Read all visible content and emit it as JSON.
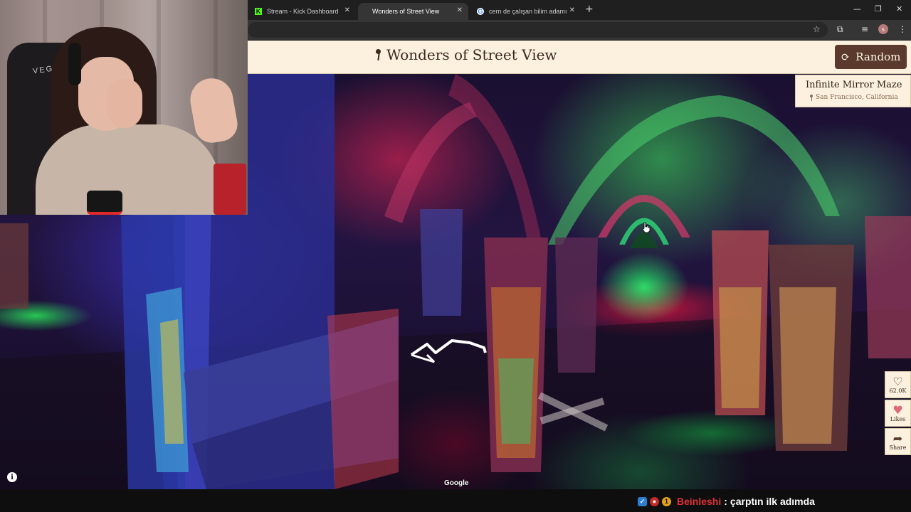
{
  "browser": {
    "tabs": [
      {
        "title": "Stream - Kick Dashboard",
        "favicon": "kick-icon",
        "active": false
      },
      {
        "title": "Wonders of Street View",
        "favicon": "",
        "active": true
      },
      {
        "title": "cern de çalışan bilim adamı - G",
        "favicon": "google-icon",
        "active": false
      }
    ],
    "new_tab": "+",
    "window_controls": {
      "minimize": "—",
      "restore": "❐",
      "close": "✕"
    },
    "profile_initial": "s"
  },
  "site": {
    "title": "Wonders of Street View",
    "random_label": "Random",
    "accent_color": "#5a3a2c",
    "header_bg": "#fbf1de"
  },
  "place": {
    "name": "Infinite Mirror Maze",
    "location": "San Francisco, California"
  },
  "side_actions": {
    "like_count": "62.0K",
    "likes_label": "Likes",
    "share_label": "Share"
  },
  "map": {
    "attribution": "Google",
    "info_label": "i"
  },
  "webcam": {
    "chair_brand": "VEGA"
  },
  "chat": {
    "username": "Beinleshi",
    "separator": ":",
    "message": "çarptın ilk adımda",
    "badge_numeral": "1"
  }
}
